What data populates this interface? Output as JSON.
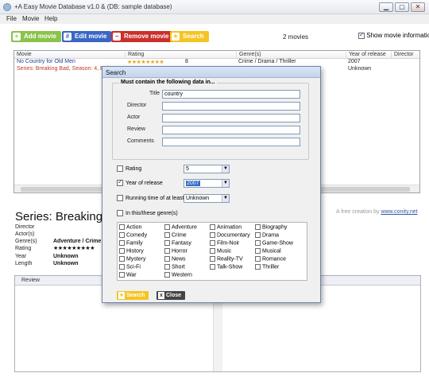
{
  "window": {
    "title": "+A Easy Movie Database v1.0 & (DB: sample database)",
    "menu": [
      "File",
      "Movie",
      "Help"
    ]
  },
  "toolbar": {
    "add_label": "Add movie",
    "edit_label": "Edit movie",
    "remove_label": "Remove movie",
    "search_label": "Search",
    "movie_count": "2 movies",
    "show_info_label": "Show movie information",
    "show_info_checked": true
  },
  "list": {
    "columns": [
      "Movie",
      "Rating",
      "Genre(s)",
      "Year of release",
      "Director"
    ],
    "rows": [
      {
        "movie": "No Country for Old Men",
        "stars": "★★★★★★★★",
        "rating": "8",
        "genres": "Crime / Drama / Thriller",
        "year": "2007",
        "director": ""
      },
      {
        "movie": "Series: Breaking Bad, Season: 4, Epis",
        "stars": "",
        "rating": "",
        "genres": "",
        "year": "Unknown",
        "director": ""
      }
    ]
  },
  "details": {
    "title": "Series: Breaking E",
    "credit_text": "A free creation by",
    "credit_link": "www.conity.net",
    "labels": [
      "Director",
      "Actor(s)",
      "Genre(s)",
      "Rating",
      "Year",
      "Length"
    ],
    "genres_value": "Adventure / Crime",
    "rating_stars": "★★★★★★★★★",
    "year_value": "Unknown",
    "length_value": "Unknown",
    "review_tab": "Review"
  },
  "search_dialog": {
    "title": "Search",
    "legend": "Must contain the following data in...",
    "fields": [
      {
        "label": "Title",
        "value": "country"
      },
      {
        "label": "Director",
        "value": ""
      },
      {
        "label": "Actor",
        "value": ""
      },
      {
        "label": "Review",
        "value": ""
      },
      {
        "label": "Comments",
        "value": ""
      }
    ],
    "rating_label": "Rating",
    "rating_value": "5",
    "year_label": "Year of release",
    "year_value": "2007",
    "year_checked": true,
    "runtime_label": "Running time of at least",
    "runtime_value": "Unknown",
    "genre_label": "In this/these genre(s)",
    "genres": [
      [
        "Action",
        "Adventure",
        "Animation",
        "Biography"
      ],
      [
        "Comedy",
        "Crime",
        "Documentary",
        "Drama"
      ],
      [
        "Family",
        "Fantasy",
        "Film-Noir",
        "Game-Show"
      ],
      [
        "History",
        "Horror",
        "Music",
        "Musical"
      ],
      [
        "Mystery",
        "News",
        "Reality-TV",
        "Romance"
      ],
      [
        "Sci-Fi",
        "Short",
        "Talk-Show",
        "Thriller"
      ],
      [
        "War",
        "Western"
      ]
    ],
    "search_button": "Search",
    "close_button": "Close"
  },
  "colors": {
    "add": "#8bc34a",
    "edit": "#3a66c4",
    "remove": "#c9302c",
    "search": "#f3c524",
    "series_row_text": "#c0392b",
    "movie_row_text": "#1f3f99"
  }
}
